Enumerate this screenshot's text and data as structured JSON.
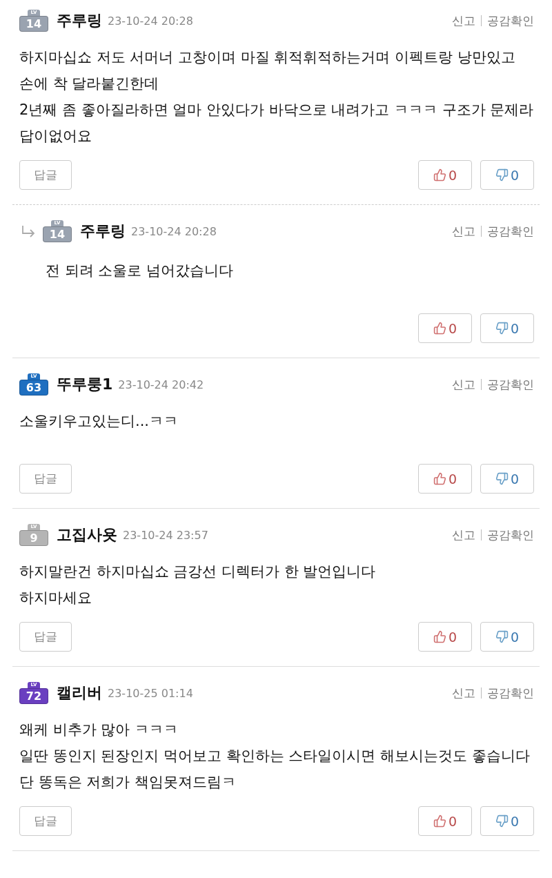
{
  "comments": [
    {
      "kind": "comment",
      "badge": {
        "lv": "LV",
        "level": "14",
        "color": "#9aa3b0"
      },
      "name": "주루링",
      "date": "23-10-24 20:28",
      "report": "신고",
      "check": "공감확인",
      "body": [
        "하지마십쇼 저도 서머너 고창이며 마질 휘적휘적하는거며 이펙트랑 낭만있고 손에 착 달라붙긴한데",
        "2년째 좀 좋아질라하면 얼마 안있다가 바닥으로 내려가고 ㅋㅋㅋ 구조가 문제라 답이없어요"
      ],
      "reply_button": "답글",
      "likes": "0",
      "dislikes": "0"
    },
    {
      "kind": "reply",
      "badge": {
        "lv": "LV",
        "level": "14",
        "color": "#9aa3b0"
      },
      "name": "주루링",
      "date": "23-10-24 20:28",
      "report": "신고",
      "check": "공감확인",
      "body": [
        "전 되려 소울로 넘어갔습니다"
      ],
      "likes": "0",
      "dislikes": "0"
    },
    {
      "kind": "comment",
      "badge": {
        "lv": "LV",
        "level": "63",
        "color": "#1f6fc0"
      },
      "name": "뚜루룽1",
      "date": "23-10-24 20:42",
      "report": "신고",
      "check": "공감확인",
      "body": [
        "소울키우고있는디...ㅋㅋ"
      ],
      "reply_button": "답글",
      "likes": "0",
      "dislikes": "0"
    },
    {
      "kind": "comment",
      "badge": {
        "lv": "LV",
        "level": "9",
        "color": "#b4b4b4"
      },
      "name": "고집사욧",
      "date": "23-10-24 23:57",
      "report": "신고",
      "check": "공감확인",
      "body": [
        "하지말란건 하지마십쇼 금강선 디렉터가 한 발언입니다",
        "하지마세요"
      ],
      "reply_button": "답글",
      "likes": "0",
      "dislikes": "0"
    },
    {
      "kind": "comment",
      "badge": {
        "lv": "LV",
        "level": "72",
        "color": "#6a3fc0"
      },
      "name": "캘리버",
      "date": "23-10-25 01:14",
      "report": "신고",
      "check": "공감확인",
      "body": [
        "왜케 비추가 많아 ㅋㅋㅋ",
        "일딴 똥인지 된장인지 먹어보고 확인하는 스타일이시면 해보시는것도 좋습니다",
        "단 똥독은 저희가 책임못져드림ㅋ"
      ],
      "reply_button": "답글",
      "likes": "0",
      "dislikes": "0"
    }
  ]
}
